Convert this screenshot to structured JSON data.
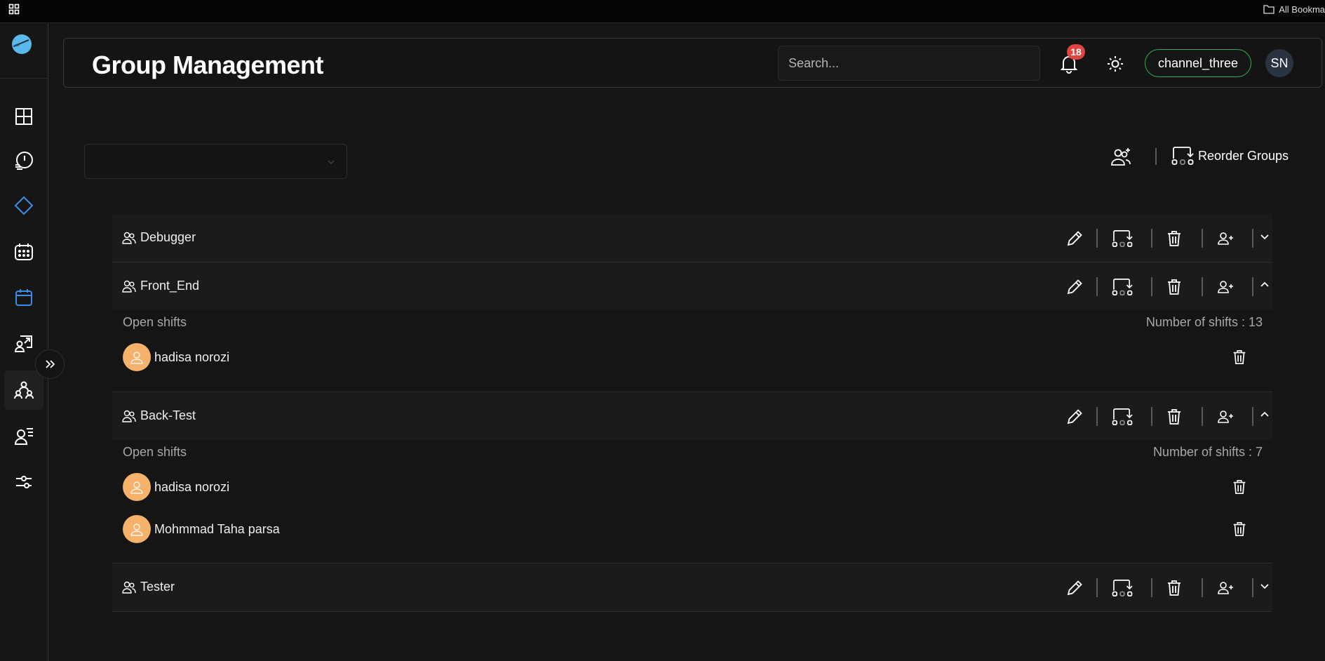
{
  "browser": {
    "bookmarks_label": "All Bookma"
  },
  "header": {
    "title": "Group Management",
    "search_placeholder": "Search...",
    "notification_count": "18",
    "channel": "channel_three",
    "user_initials": "SN"
  },
  "toolbar": {
    "reorder_label": "Reorder Groups"
  },
  "sidebar": {
    "items": [
      {
        "icon": "dashboard-icon"
      },
      {
        "icon": "clock-icon"
      },
      {
        "icon": "diamond-icon"
      },
      {
        "icon": "calendar-grid-icon"
      },
      {
        "icon": "calendar-icon"
      },
      {
        "icon": "screen-share-icon"
      },
      {
        "icon": "groups-icon",
        "active": true
      },
      {
        "icon": "user-list-icon"
      },
      {
        "icon": "sliders-icon"
      }
    ]
  },
  "groups": [
    {
      "name": "Debugger",
      "expanded": false
    },
    {
      "name": "Front_End",
      "expanded": true,
      "open_shifts_label": "Open shifts",
      "num_shifts_label": "Number of shifts : 13",
      "members": [
        {
          "name": "hadisa norozi"
        }
      ]
    },
    {
      "name": "Back-Test",
      "expanded": true,
      "open_shifts_label": "Open shifts",
      "num_shifts_label": "Number of shifts : 7",
      "members": [
        {
          "name": "hadisa norozi"
        },
        {
          "name": "Mohmmad Taha parsa"
        }
      ]
    },
    {
      "name": "Tester",
      "expanded": false
    }
  ],
  "colors": {
    "accent_blue": "#3b8ee6",
    "channel_border": "#2fae52",
    "badge": "#e0443e",
    "avatar": "#f6b26b"
  }
}
